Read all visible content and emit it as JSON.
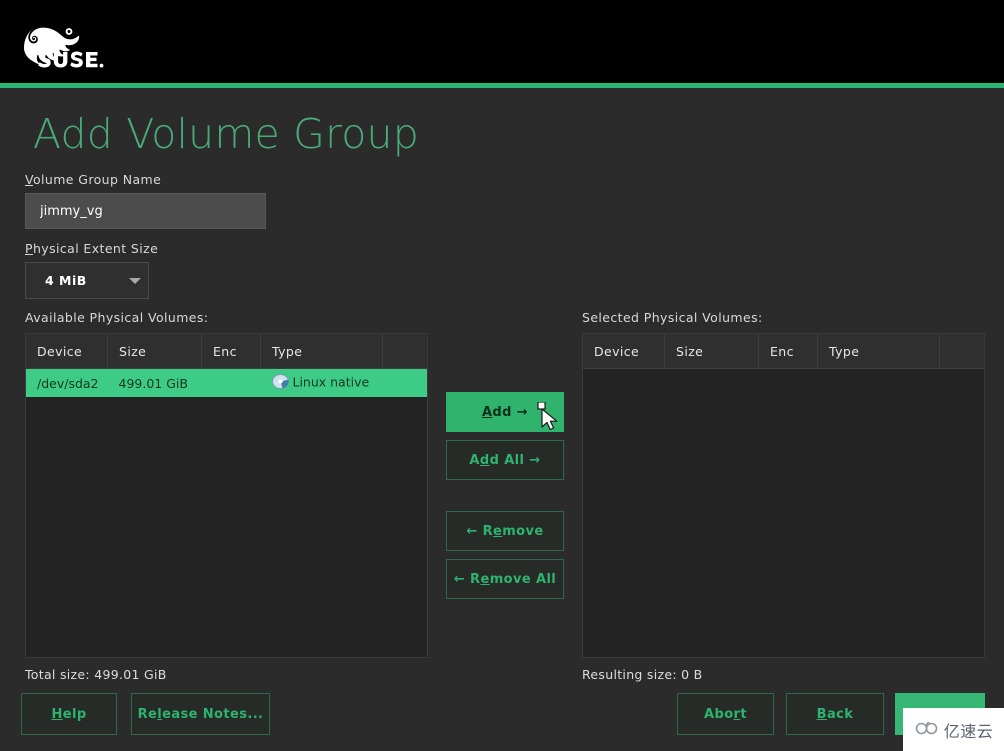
{
  "header": {
    "logo_alt": "SUSE",
    "logo_wordmark": "SUSE."
  },
  "page_title": "Add Volume Group",
  "form": {
    "vg_name": {
      "label_pre": "V",
      "label_acc": "",
      "label_post": "olume Group Name",
      "label_full": "Volume Group Name",
      "value": "jimmy_vg"
    },
    "extent_size": {
      "label_full": "Physical Extent Size",
      "label_acc": "P",
      "label_post": "hysical Extent Size",
      "selected": "4 MiB",
      "options": [
        "4 MiB"
      ]
    }
  },
  "available": {
    "heading": "Available Physical Volumes:",
    "columns": [
      "Device",
      "Size",
      "Enc",
      "Type"
    ],
    "rows": [
      {
        "device": "/dev/sda2",
        "size": "499.01 GiB",
        "enc": "",
        "type": "Linux native",
        "icon": "disk-icon",
        "selected": true
      }
    ],
    "total_label": "Total size: 499.01 GiB"
  },
  "selected": {
    "heading": "Selected Physical Volumes:",
    "columns": [
      "Device",
      "Size",
      "Enc",
      "Type"
    ],
    "rows": [],
    "total_label": "Resulting size: 0 B"
  },
  "transfer_buttons": {
    "add": {
      "acc": "A",
      "rest": "dd →",
      "full": "Add →"
    },
    "add_all": {
      "acc": "A",
      "rest": "dd All →",
      "full": "Add All →"
    },
    "remove": {
      "pre": "← R",
      "acc": "e",
      "rest": "move",
      "full": "← Remove"
    },
    "remove_all": {
      "pre": "← R",
      "acc": "e",
      "rest": "move All",
      "full": "← Remove All"
    }
  },
  "footer": {
    "help": {
      "pre": "H",
      "acc": "",
      "rest": "elp",
      "full": "Help"
    },
    "release_notes": {
      "full": "Release Notes...",
      "acc": "l"
    },
    "abort": {
      "full": "Abort",
      "acc": "r"
    },
    "back": {
      "full": "Back",
      "acc": "B"
    },
    "next": {
      "full": ""
    }
  },
  "watermark": {
    "text": "亿速云"
  },
  "colors": {
    "accent_green": "#2bb673",
    "title_green": "#4aab78",
    "button_green": "#2fb36d",
    "selection_green": "#3ecb86",
    "page_bg": "#2b2b2b",
    "panel_bg": "#232323",
    "header_bg": "#000000",
    "input_bg": "#4c4c4c"
  }
}
